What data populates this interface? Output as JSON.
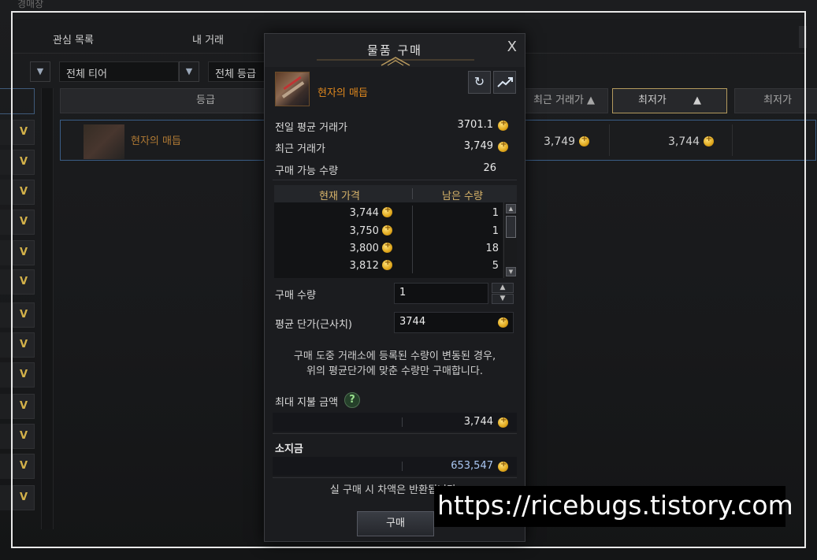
{
  "background": {
    "window_title": "경매장",
    "tabs": [
      "관심 목록",
      "내 거래"
    ],
    "filters": {
      "tier": "전체 티어",
      "grade": "전체 등급"
    },
    "columns": {
      "grade": "등급",
      "recent_price": "최근 거래가",
      "lowest_price": "최저가",
      "lowest_price_2": "최저가"
    },
    "row": {
      "name": "현자의 매듭",
      "recent_price": "3,749",
      "lowest_price": "3,744"
    },
    "sort_icon": "triangle-up-icon"
  },
  "modal": {
    "title": "물품 구매",
    "close_label": "X",
    "item_name": "현자의 매듭",
    "refresh_icon": "refresh-icon",
    "chart_icon": "chart-icon",
    "stats": [
      {
        "label": "전일 평균 거래가",
        "value": "3701.1"
      },
      {
        "label": "최근 거래가",
        "value": "3,749"
      },
      {
        "label": "구매 가능 수량",
        "value": "26"
      }
    ],
    "table": {
      "col_price": "현재 가격",
      "col_qty": "남은 수량",
      "rows": [
        {
          "price": "3,744",
          "qty": "1"
        },
        {
          "price": "3,750",
          "qty": "1"
        },
        {
          "price": "3,800",
          "qty": "18"
        },
        {
          "price": "3,812",
          "qty": "5"
        }
      ]
    },
    "quantity_label": "구매 수량",
    "quantity_value": "1",
    "avg_unit_label": "평균 단가(근사치)",
    "avg_unit_value": "3744",
    "notice_line1": "구매 도중 거래소에 등록된 수량이 변동된 경우,",
    "notice_line2": "위의 평균단가에 맞춘 수량만 구매합니다.",
    "max_pay_label": "최대 지불 금액",
    "max_pay_help": "?",
    "max_pay_value": "3,744",
    "balance_label": "소지금",
    "balance_value": "653,547",
    "refund_notice": "실 구매 시 차액은 반환됩니다.",
    "buy_button": "구매",
    "colors": {
      "item_name": "#e0881e",
      "balance": "#a9c6f2",
      "table_header": "#d8b46a"
    }
  },
  "watermark": "https://ricebugs.tistory.com"
}
